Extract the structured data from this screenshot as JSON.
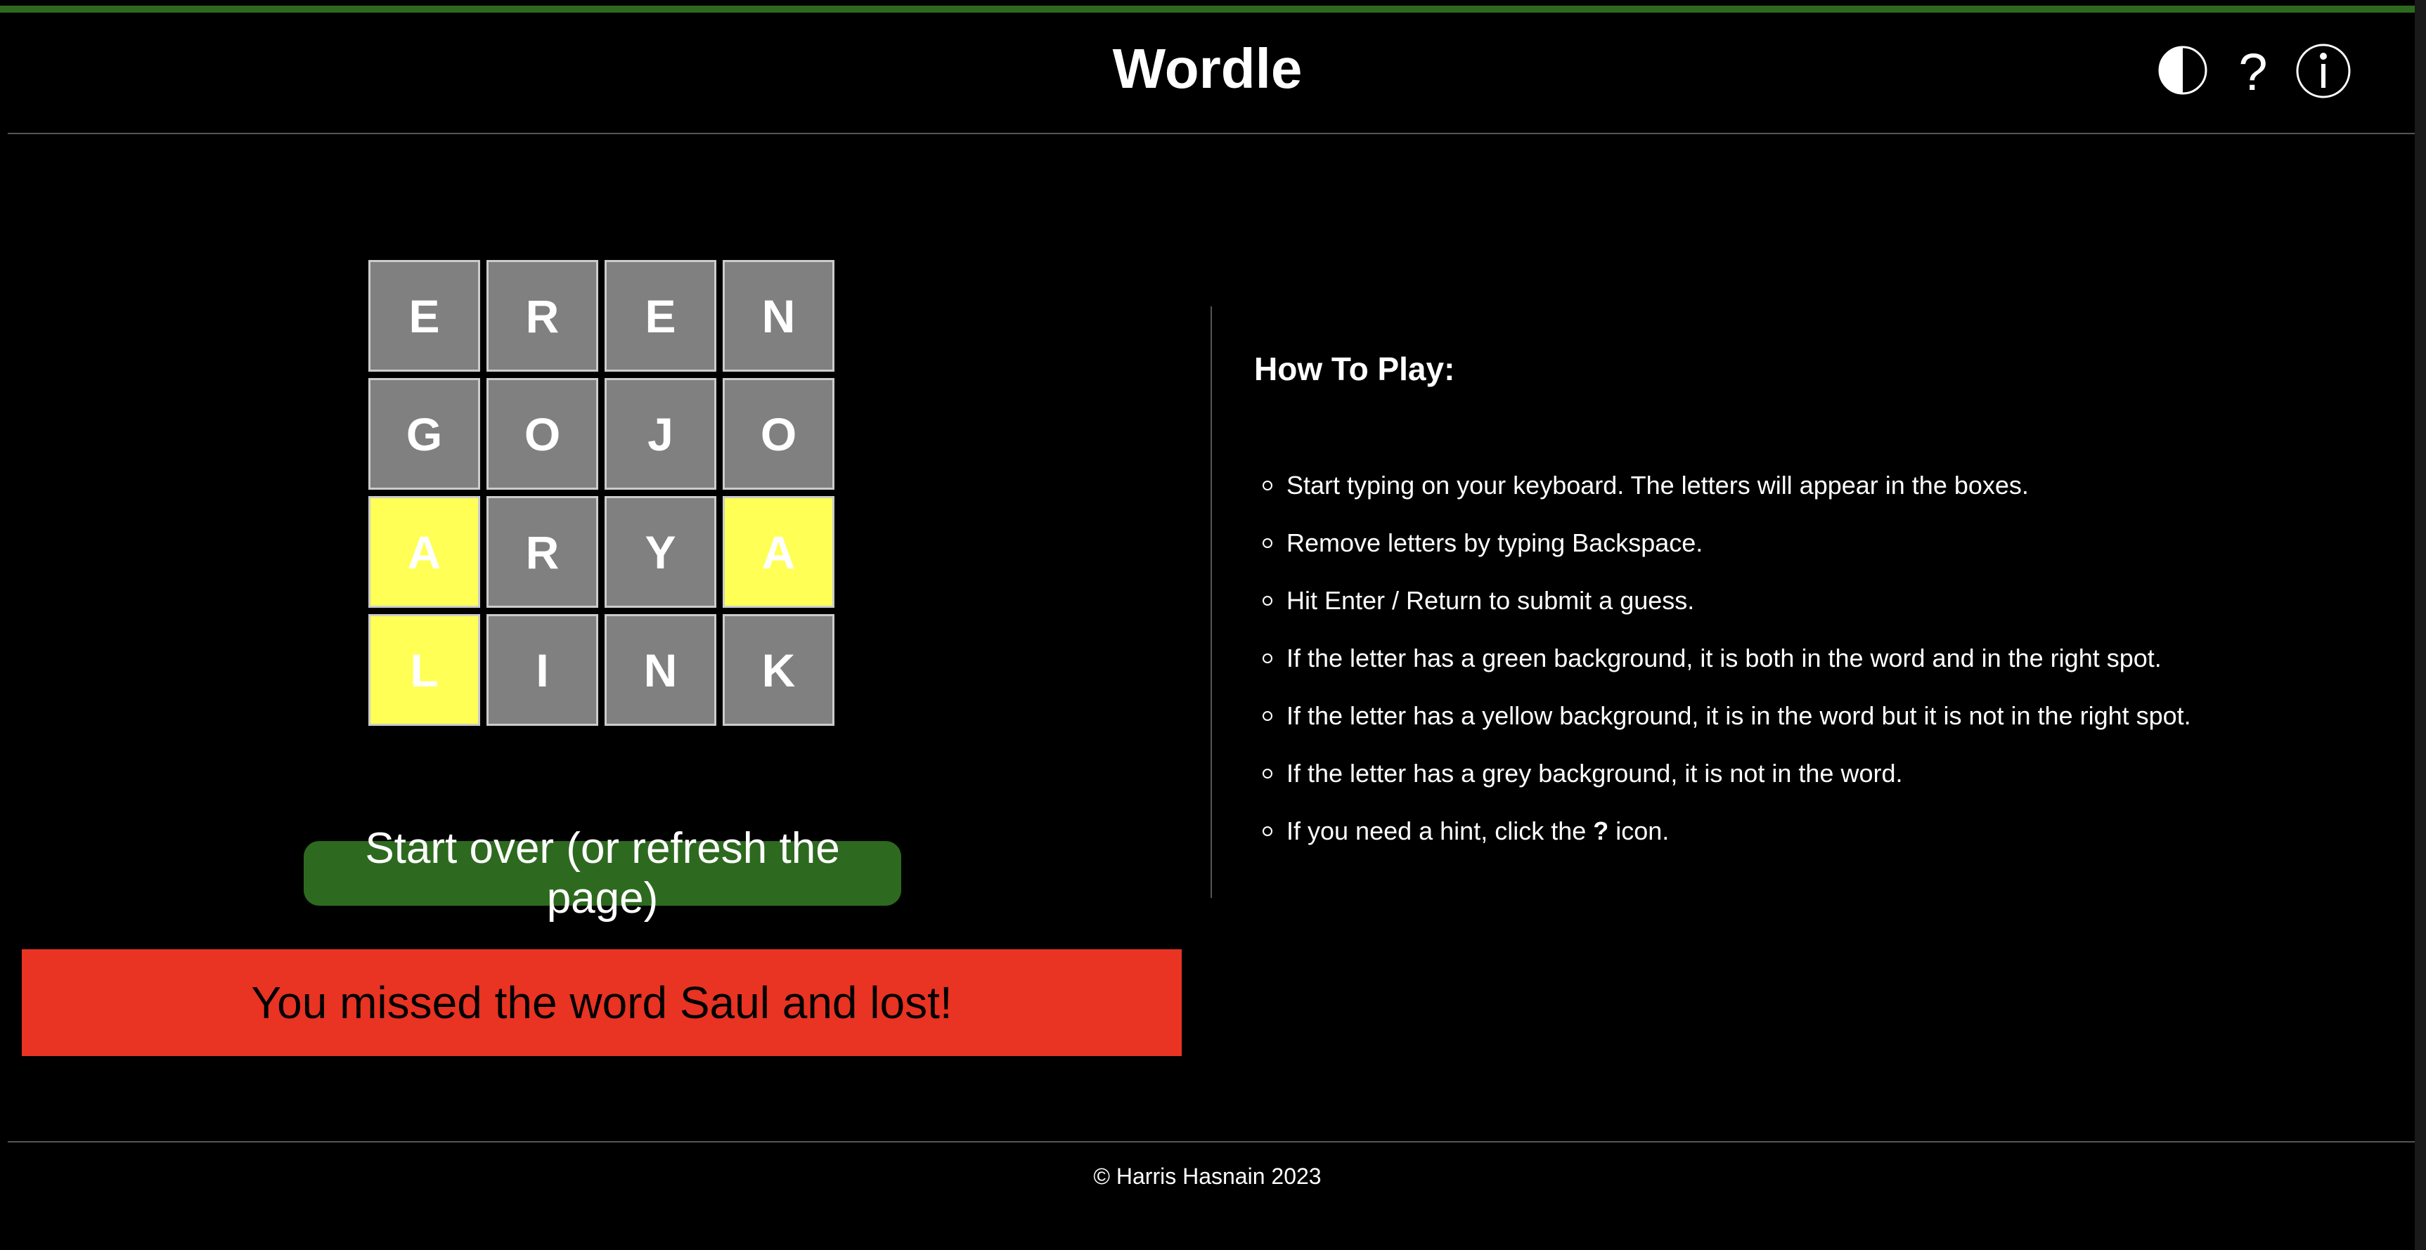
{
  "header": {
    "title": "Wordle",
    "icons": [
      "contrast-icon",
      "help-icon",
      "info-icon"
    ],
    "accent_color": "#2d6a1f"
  },
  "board": {
    "rows": [
      [
        {
          "letter": "E",
          "state": "absent"
        },
        {
          "letter": "R",
          "state": "absent"
        },
        {
          "letter": "E",
          "state": "absent"
        },
        {
          "letter": "N",
          "state": "absent"
        }
      ],
      [
        {
          "letter": "G",
          "state": "absent"
        },
        {
          "letter": "O",
          "state": "absent"
        },
        {
          "letter": "J",
          "state": "absent"
        },
        {
          "letter": "O",
          "state": "absent"
        }
      ],
      [
        {
          "letter": "A",
          "state": "present"
        },
        {
          "letter": "R",
          "state": "absent"
        },
        {
          "letter": "Y",
          "state": "absent"
        },
        {
          "letter": "A",
          "state": "present"
        }
      ],
      [
        {
          "letter": "L",
          "state": "present"
        },
        {
          "letter": "I",
          "state": "absent"
        },
        {
          "letter": "N",
          "state": "absent"
        },
        {
          "letter": "K",
          "state": "absent"
        }
      ]
    ],
    "colors": {
      "absent": "#808080",
      "present": "#ffff55"
    }
  },
  "start_over_label": "Start over (or refresh the page)",
  "result_message": "You missed the word Saul and lost!",
  "result_color": "#e93323",
  "how_to_play": {
    "heading": "How To Play:",
    "rules": [
      "Start typing on your keyboard. The letters will appear in the boxes.",
      "Remove letters by typing Backspace.",
      "Hit Enter / Return to submit a guess.",
      "If the letter has a green background, it is both in the word and in the right spot.",
      "If the letter has a yellow background, it is in the word but it is not in the right spot.",
      "If the letter has a grey background, it is not in the word."
    ],
    "hint_rule": {
      "before": "If you need a hint, click the ",
      "symbol": "?",
      "after": " icon."
    }
  },
  "footer": "© Harris Hasnain 2023"
}
